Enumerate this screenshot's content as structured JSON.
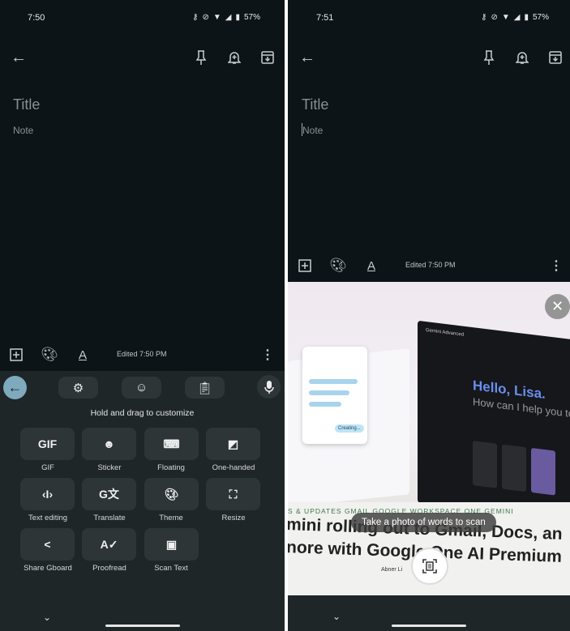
{
  "left": {
    "status": {
      "time": "7:50",
      "battery": "57%"
    },
    "note": {
      "title_placeholder": "Title",
      "note_placeholder": "Note"
    },
    "toolbar": {
      "edited": "Edited 7:50 PM"
    },
    "keyboard": {
      "hint": "Hold and drag to customize",
      "gif_glyph": "GIF",
      "items": [
        {
          "label": "GIF",
          "icon": "gif-icon"
        },
        {
          "label": "Sticker",
          "icon": "sticker-icon"
        },
        {
          "label": "Floating",
          "icon": "keyboard-icon"
        },
        {
          "label": "One-handed",
          "icon": "one-handed-icon"
        },
        {
          "label": "Text editing",
          "icon": "text-cursor-icon"
        },
        {
          "label": "Translate",
          "icon": "translate-icon"
        },
        {
          "label": "Theme",
          "icon": "palette-icon"
        },
        {
          "label": "Resize",
          "icon": "resize-icon"
        },
        {
          "label": "Share Gboard",
          "icon": "share-icon"
        },
        {
          "label": "Proofread",
          "icon": "proofread-icon"
        },
        {
          "label": "Scan Text",
          "icon": "scan-text-icon"
        }
      ]
    }
  },
  "right": {
    "status": {
      "time": "7:51",
      "battery": "57%"
    },
    "note": {
      "title_placeholder": "Title",
      "note_placeholder": "Note"
    },
    "toolbar": {
      "edited": "Edited 7:50 PM"
    },
    "camera": {
      "hint": "Take a photo of words to scan",
      "photo": {
        "greeting": "Hello, Lisa.",
        "question": "How can I help you today?",
        "nav": "S & UPDATES   GMAIL   GOOGLE WORKSPACE   ONE   GEMINI",
        "headline1": "mini rolling out to Gmail, Docs, an",
        "headline2": "nore with Google One AI Premium",
        "byline": "Abner Li",
        "app_name": "Gemini Advanced",
        "creating": "Creating..."
      }
    }
  }
}
